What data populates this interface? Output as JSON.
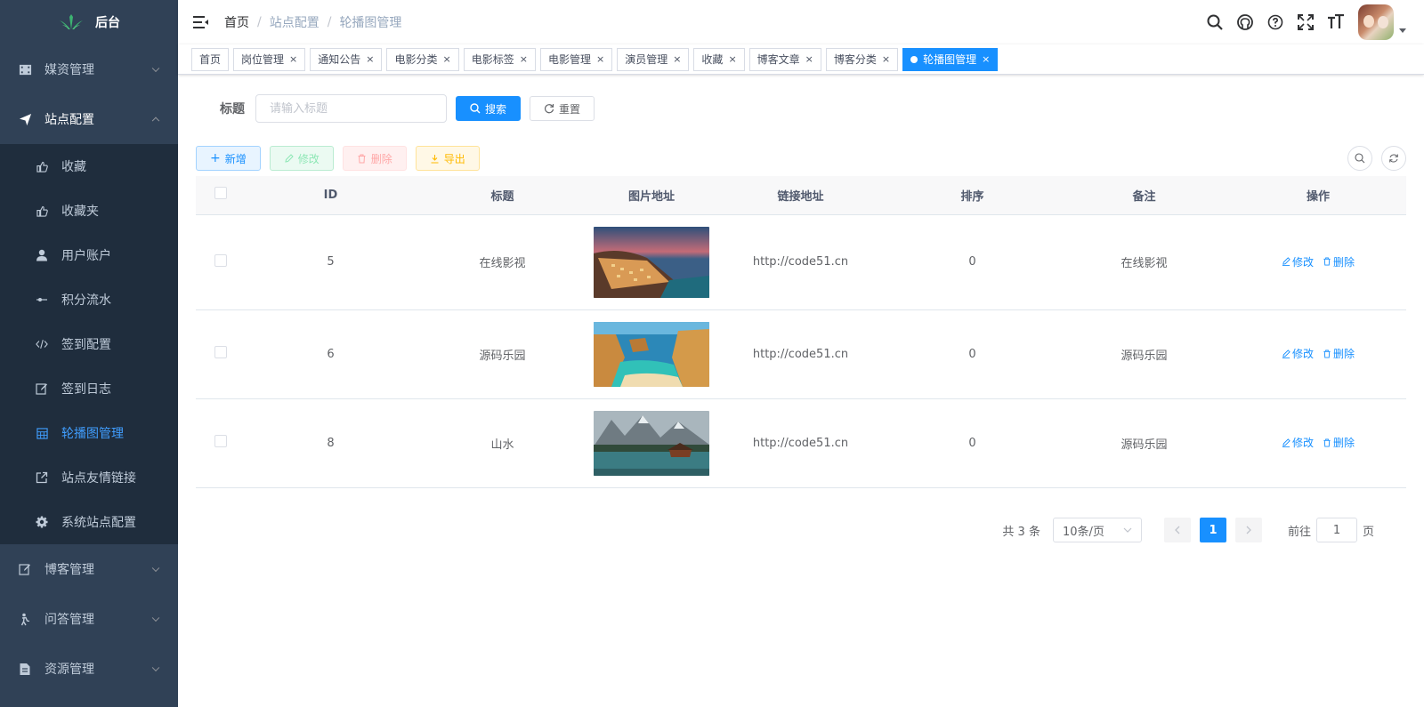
{
  "app": {
    "logo_text": "后台"
  },
  "sidebar": {
    "top_menus_before": [
      {
        "label": "媒资管理",
        "icon": "film-icon",
        "opened": false
      }
    ],
    "open_menu": {
      "label": "站点配置",
      "icon": "send-icon",
      "opened": true
    },
    "sub_items": [
      {
        "label": "收藏",
        "icon": "thumb-icon",
        "active": false
      },
      {
        "label": "收藏夹",
        "icon": "thumb-icon",
        "active": false
      },
      {
        "label": "用户账户",
        "icon": "user-icon",
        "active": false
      },
      {
        "label": "积分流水",
        "icon": "dot-line-icon",
        "active": false
      },
      {
        "label": "签到配置",
        "icon": "code-icon",
        "active": false
      },
      {
        "label": "签到日志",
        "icon": "edit-icon",
        "active": false
      },
      {
        "label": "轮播图管理",
        "icon": "grid-icon",
        "active": true
      },
      {
        "label": "站点友情链接",
        "icon": "external-link-icon",
        "active": false
      },
      {
        "label": "系统站点配置",
        "icon": "gear-icon",
        "active": false
      }
    ],
    "top_menus_after": [
      {
        "label": "博客管理",
        "icon": "edit-icon"
      },
      {
        "label": "问答管理",
        "icon": "person-icon"
      },
      {
        "label": "资源管理",
        "icon": "doc-icon"
      }
    ]
  },
  "breadcrumb": [
    "首页",
    "站点配置",
    "轮播图管理"
  ],
  "tags": [
    {
      "label": "首页",
      "closable": false,
      "active": false
    },
    {
      "label": "岗位管理",
      "closable": true,
      "active": false
    },
    {
      "label": "通知公告",
      "closable": true,
      "active": false
    },
    {
      "label": "电影分类",
      "closable": true,
      "active": false
    },
    {
      "label": "电影标签",
      "closable": true,
      "active": false
    },
    {
      "label": "电影管理",
      "closable": true,
      "active": false
    },
    {
      "label": "演员管理",
      "closable": true,
      "active": false
    },
    {
      "label": "收藏",
      "closable": true,
      "active": false
    },
    {
      "label": "博客文章",
      "closable": true,
      "active": false
    },
    {
      "label": "博客分类",
      "closable": true,
      "active": false
    },
    {
      "label": "轮播图管理",
      "closable": true,
      "active": true
    }
  ],
  "search": {
    "label": "标题",
    "placeholder": "请输入标题",
    "search_label": "搜索",
    "reset_label": "重置"
  },
  "toolbar": {
    "add_label": "新增",
    "edit_label": "修改",
    "delete_label": "删除",
    "export_label": "导出"
  },
  "table": {
    "headers": [
      "ID",
      "标题",
      "图片地址",
      "链接地址",
      "排序",
      "备注",
      "操作"
    ],
    "rows": [
      {
        "id": "5",
        "title": "在线影视",
        "image": "coastal-village",
        "link": "http://code51.cn",
        "sort": "0",
        "remark": "在线影视"
      },
      {
        "id": "6",
        "title": "源码乐园",
        "image": "beach-cliffs",
        "link": "http://code51.cn",
        "sort": "0",
        "remark": "源码乐园"
      },
      {
        "id": "8",
        "title": "山水",
        "image": "mountain-lake",
        "link": "http://code51.cn",
        "sort": "0",
        "remark": "源码乐园"
      }
    ],
    "edit_label": "修改",
    "delete_label": "删除"
  },
  "pagination": {
    "total": "共 3 条",
    "page_size": "10条/页",
    "current": "1",
    "goto_prefix": "前往",
    "goto_value": "1",
    "goto_suffix": "页"
  },
  "colors": {
    "sidebar_bg": "#304156",
    "submenu_bg": "#1f2d3d",
    "primary": "#1890ff"
  }
}
